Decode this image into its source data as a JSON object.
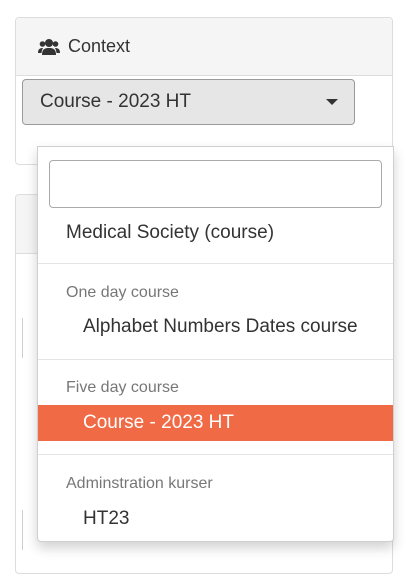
{
  "context_panel": {
    "title": "Context",
    "selected_value": "Course - 2023 HT"
  },
  "dropdown": {
    "search_value": "",
    "top_option": "Medical Society (course)",
    "groups": [
      {
        "label": "One day course",
        "options": [
          "Alphabet Numbers Dates course"
        ]
      },
      {
        "label": "Five day course",
        "options": [
          "Course - 2023 HT"
        ]
      },
      {
        "label": "Adminstration kurser",
        "options": [
          "HT23"
        ]
      }
    ]
  },
  "colors": {
    "selected_highlight": "#ef6a45",
    "select_background": "#e6e6e6"
  },
  "icons": {
    "context_icon": "users-icon"
  }
}
